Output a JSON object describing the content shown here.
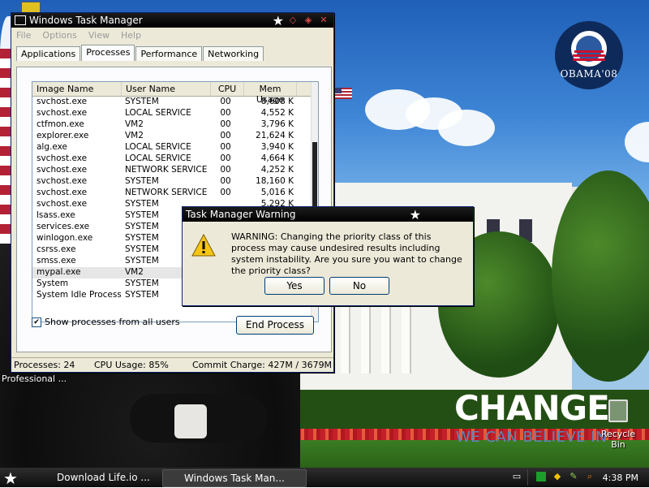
{
  "desktop": {
    "logo_text": "OBAMA'08",
    "slogan_title": "CHANGE",
    "slogan_sub": "WE CAN BELIEVE IN",
    "recycle_bin_label": "Recycle Bin",
    "left_icon_label": "Professional ..."
  },
  "task_manager": {
    "title": "Windows Task Manager",
    "menu": [
      "File",
      "Options",
      "View",
      "Help"
    ],
    "tabs": [
      "Applications",
      "Processes",
      "Performance",
      "Networking"
    ],
    "active_tab": "Processes",
    "columns": [
      "Image Name",
      "User Name",
      "CPU",
      "Mem Usage"
    ],
    "processes": [
      {
        "name": "svchost.exe",
        "user": "SYSTEM",
        "cpu": "00",
        "mem": "8,608 K"
      },
      {
        "name": "svchost.exe",
        "user": "LOCAL SERVICE",
        "cpu": "00",
        "mem": "4,552 K"
      },
      {
        "name": "ctfmon.exe",
        "user": "VM2",
        "cpu": "00",
        "mem": "3,796 K"
      },
      {
        "name": "explorer.exe",
        "user": "VM2",
        "cpu": "00",
        "mem": "21,624 K"
      },
      {
        "name": "alg.exe",
        "user": "LOCAL SERVICE",
        "cpu": "00",
        "mem": "3,940 K"
      },
      {
        "name": "svchost.exe",
        "user": "LOCAL SERVICE",
        "cpu": "00",
        "mem": "4,664 K"
      },
      {
        "name": "svchost.exe",
        "user": "NETWORK SERVICE",
        "cpu": "00",
        "mem": "4,252 K"
      },
      {
        "name": "svchost.exe",
        "user": "SYSTEM",
        "cpu": "00",
        "mem": "18,160 K"
      },
      {
        "name": "svchost.exe",
        "user": "NETWORK SERVICE",
        "cpu": "00",
        "mem": "5,016 K"
      },
      {
        "name": "svchost.exe",
        "user": "SYSTEM",
        "cpu": "",
        "mem": "5,292 K"
      },
      {
        "name": "lsass.exe",
        "user": "SYSTEM",
        "cpu": "",
        "mem": ""
      },
      {
        "name": "services.exe",
        "user": "SYSTEM",
        "cpu": "",
        "mem": ""
      },
      {
        "name": "winlogon.exe",
        "user": "SYSTEM",
        "cpu": "",
        "mem": ""
      },
      {
        "name": "csrss.exe",
        "user": "SYSTEM",
        "cpu": "",
        "mem": ""
      },
      {
        "name": "smss.exe",
        "user": "SYSTEM",
        "cpu": "",
        "mem": ""
      },
      {
        "name": "mypal.exe",
        "user": "VM2",
        "cpu": "",
        "mem": ""
      },
      {
        "name": "System",
        "user": "SYSTEM",
        "cpu": "",
        "mem": ""
      },
      {
        "name": "System Idle Process",
        "user": "SYSTEM",
        "cpu": "",
        "mem": ""
      }
    ],
    "selected_process": "mypal.exe",
    "show_all_users_label": "Show processes from all users",
    "show_all_users_checked": true,
    "end_process_label": "End Process",
    "status": {
      "processes": "Processes: 24",
      "cpu": "CPU Usage: 85%",
      "commit": "Commit Charge: 427M / 3679M"
    }
  },
  "warning_dialog": {
    "title": "Task Manager Warning",
    "message": "WARNING: Changing the priority class of this process may cause undesired results including system instability.  Are you sure you want to change the priority class?",
    "yes_label": "Yes",
    "no_label": "No"
  },
  "taskbar": {
    "items": [
      {
        "label": "Download Life.io ..."
      },
      {
        "label": "Windows Task Man..."
      }
    ],
    "clock": "4:38 PM"
  },
  "colors": {
    "titlebar": "#000000",
    "accent_red": "#e24b4b",
    "desktop_sky": "#3f86d6"
  }
}
